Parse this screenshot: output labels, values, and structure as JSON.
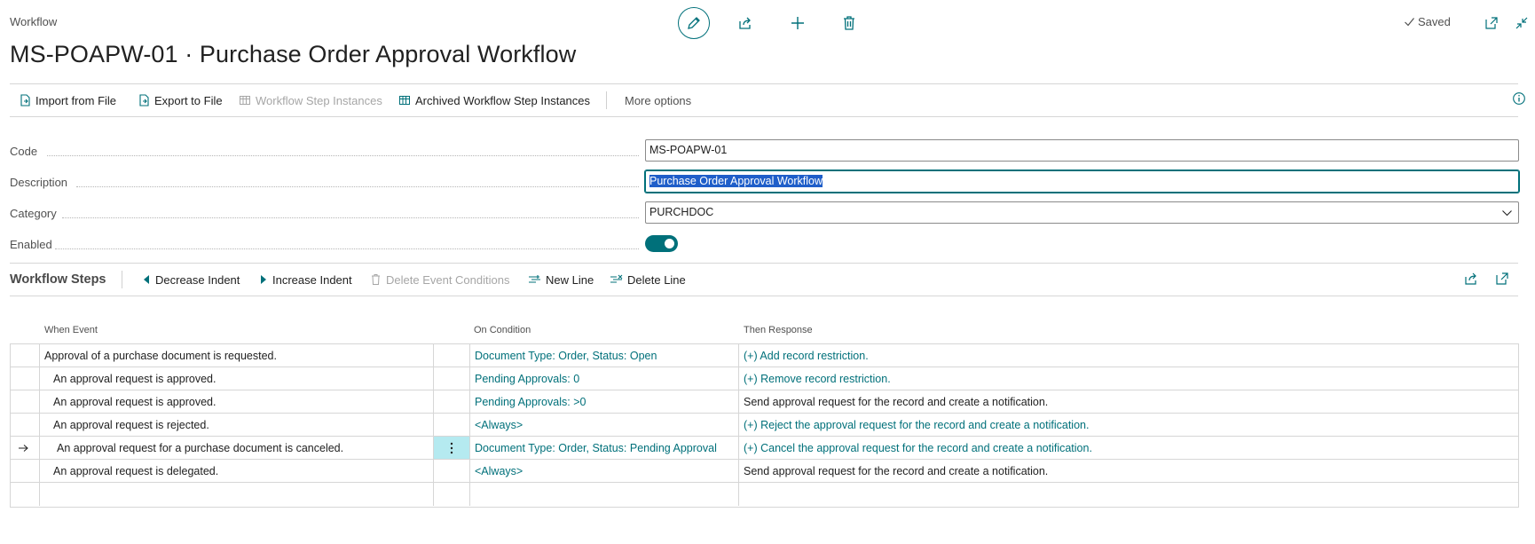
{
  "header": {
    "breadcrumb": "Workflow",
    "title": "MS-POAPW-01 · Purchase Order Approval Workflow",
    "saved_label": "Saved"
  },
  "icons": {
    "edit": "pencil-icon",
    "share": "share-icon",
    "new": "plus-icon",
    "delete": "trash-icon",
    "saved": "checkmark-icon",
    "popout": "open-new-window-icon",
    "collapse": "collapse-icon",
    "info": "info-icon"
  },
  "colors": {
    "accent": "#00707a",
    "selection": "#1f5ec9",
    "active_cell": "#b5eaf0"
  },
  "actions": {
    "import_label": "Import from File",
    "export_label": "Export to File",
    "step_instances_label": "Workflow Step Instances",
    "archived_label": "Archived Workflow Step Instances",
    "more_label": "More options"
  },
  "fields": {
    "code_label": "Code",
    "code_value": "MS-POAPW-01",
    "description_label": "Description",
    "description_value": "Purchase Order Approval Workflow",
    "category_label": "Category",
    "category_value": "PURCHDOC",
    "enabled_label": "Enabled",
    "enabled_value": true
  },
  "steps": {
    "title": "Workflow Steps",
    "decrease_label": "Decrease Indent",
    "increase_label": "Increase Indent",
    "delete_conditions_label": "Delete Event Conditions",
    "new_line_label": "New Line",
    "delete_line_label": "Delete Line",
    "columns": {
      "when": "When Event",
      "condition": "On Condition",
      "response": "Then Response"
    },
    "rows": [
      {
        "when": "Approval of a purchase document is requested.",
        "condition": "Document Type: Order, Status: Open",
        "response": "(+) Add record restriction."
      },
      {
        "when": "An approval request is approved.",
        "condition": "Pending Approvals: 0",
        "response": "(+) Remove record restriction."
      },
      {
        "when": "An approval request is approved.",
        "condition": "Pending Approvals: >0",
        "response": "Send approval request for the record and create a notification."
      },
      {
        "when": "An approval request is rejected.",
        "condition": "<Always>",
        "response": "(+) Reject the approval request for the record and create a notification."
      },
      {
        "when": "An approval request for a purchase document is canceled.",
        "condition": "Document Type: Order, Status: Pending Approval",
        "response": "(+) Cancel the approval request for the record and create a notification."
      },
      {
        "when": "An approval request is delegated.",
        "condition": "<Always>",
        "response": "Send approval request for the record and create a notification."
      },
      {
        "when": "",
        "condition": "",
        "response": ""
      }
    ]
  }
}
